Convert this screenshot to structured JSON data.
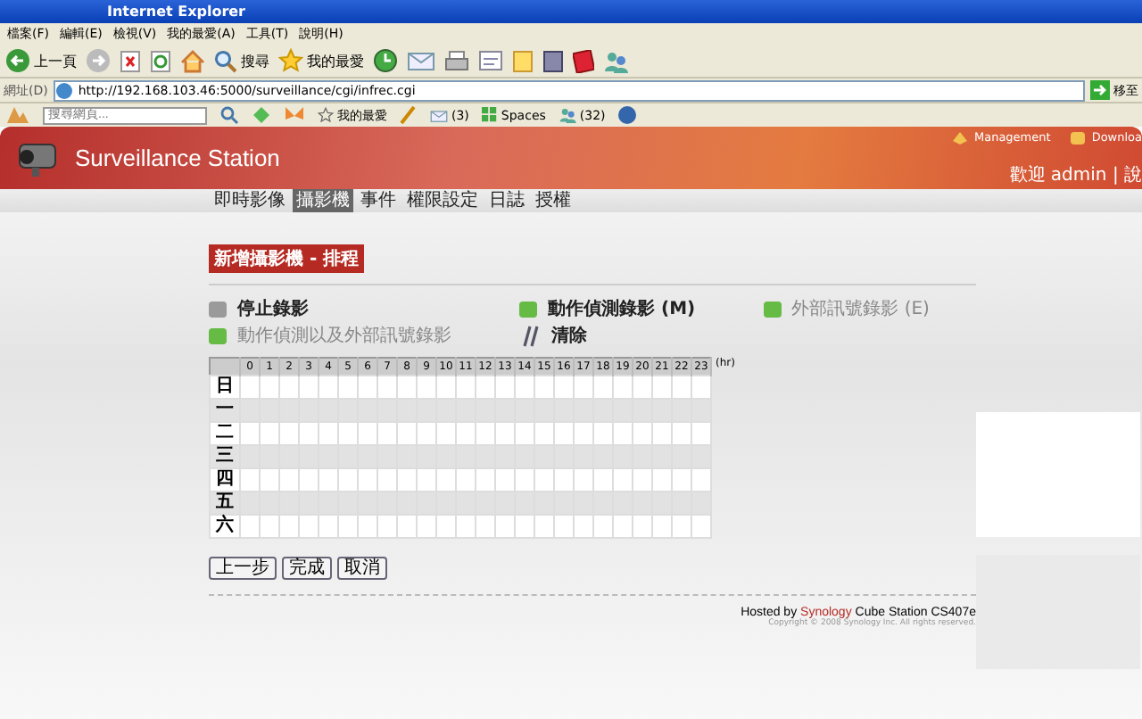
{
  "window": {
    "title": "Internet Explorer"
  },
  "menu": [
    "檔案(F)",
    "編輯(E)",
    "檢視(V)",
    "我的最愛(A)",
    "工具(T)",
    "說明(H)"
  ],
  "toolbar": {
    "back": "上一頁",
    "search": "搜尋",
    "favorites": "我的最愛"
  },
  "address": {
    "label": "網址(D)",
    "value": "http://192.168.103.46:5000/surveillance/cgi/infrec.cgi",
    "go": "移至"
  },
  "links_bar": {
    "search_placeholder": "搜尋網頁...",
    "favorites": "我的最愛",
    "mail": "(3)",
    "spaces": "Spaces",
    "messenger": "(32)"
  },
  "app": {
    "title": "Surveillance Station",
    "links": [
      "Management",
      "Downloa"
    ],
    "welcome": "歡迎 admin | 說",
    "nav": [
      {
        "label": "即時影像",
        "selected": false
      },
      {
        "label": "攝影機",
        "selected": true
      },
      {
        "label": "事件",
        "selected": false
      },
      {
        "label": "權限設定",
        "selected": false
      },
      {
        "label": "日誌",
        "selected": false
      },
      {
        "label": "授權",
        "selected": false
      }
    ],
    "step": "新增攝影機 - 排程",
    "legend": [
      {
        "label": "停止錄影",
        "color": "#9a9a9a",
        "disabled": false
      },
      {
        "label": "動作偵測錄影 (M)",
        "color": "#66bb44",
        "disabled": false
      },
      {
        "label": "外部訊號錄影 (E)",
        "color": "#66bb44",
        "disabled": true
      },
      {
        "label": "動作偵測以及外部訊號錄影",
        "color": "#66bb44",
        "disabled": true
      }
    ],
    "clear": "清除",
    "hours": [
      "0",
      "1",
      "2",
      "3",
      "4",
      "5",
      "6",
      "7",
      "8",
      "9",
      "10",
      "11",
      "12",
      "13",
      "14",
      "15",
      "16",
      "17",
      "18",
      "19",
      "20",
      "21",
      "22",
      "23"
    ],
    "unit": "(hr)",
    "days": [
      "日",
      "一",
      "二",
      "三",
      "四",
      "五",
      "六"
    ],
    "buttons": [
      "上一步",
      "完成",
      "取消"
    ],
    "footer": {
      "hosted": "Hosted by **Synology** Cube Station CS407e",
      "copyright": "Copyright © 2008 Synology Inc. All rights reserved."
    }
  }
}
